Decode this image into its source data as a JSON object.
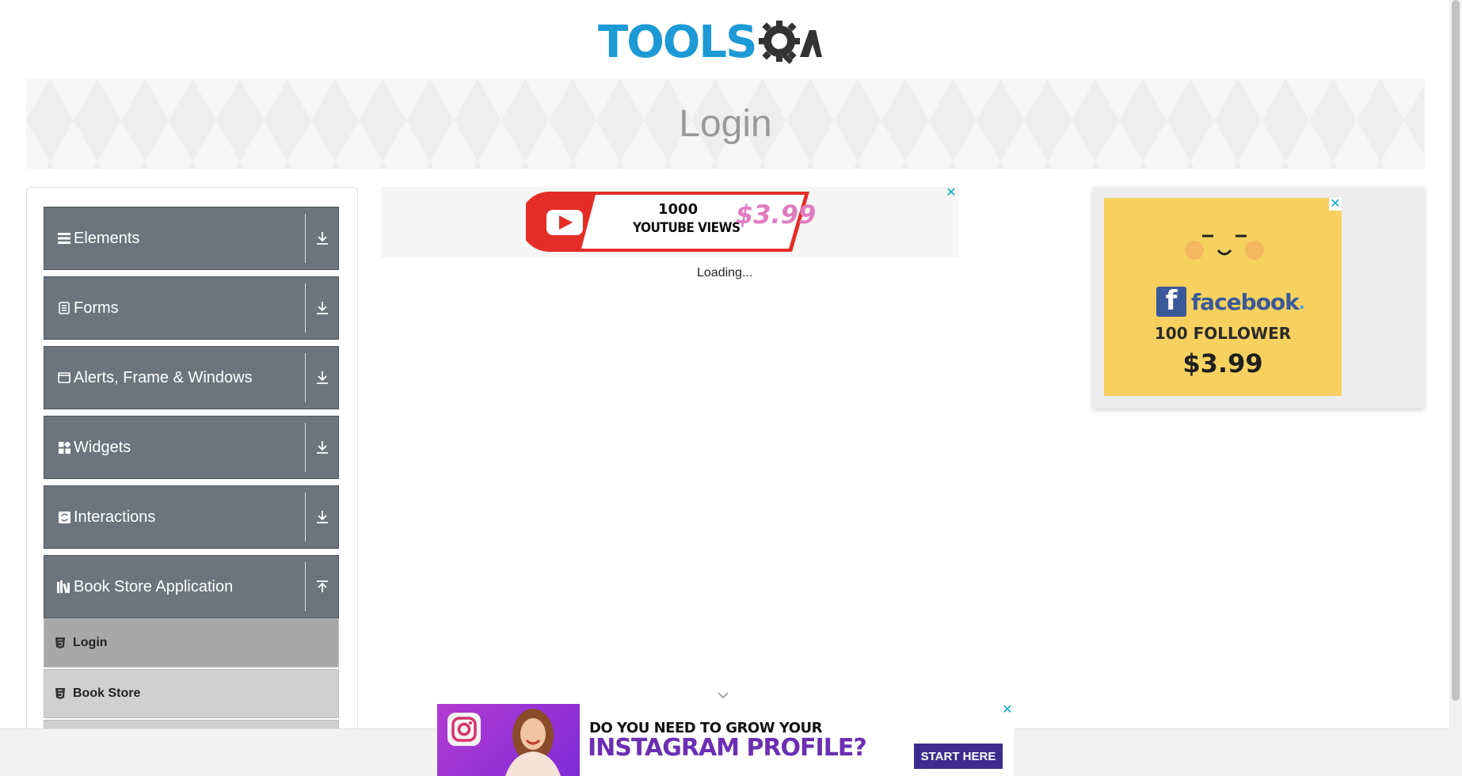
{
  "header": {
    "logo_text": "TOOLS",
    "logo_letter": "A"
  },
  "banner": {
    "title": "Login"
  },
  "sidebar": {
    "groups": [
      {
        "label": "Elements",
        "icon": "bars-icon",
        "expanded": false
      },
      {
        "label": "Forms",
        "icon": "document-icon",
        "expanded": false
      },
      {
        "label": "Alerts, Frame & Windows",
        "icon": "window-icon",
        "expanded": false
      },
      {
        "label": "Widgets",
        "icon": "widgets-icon",
        "expanded": false
      },
      {
        "label": "Interactions",
        "icon": "interactions-icon",
        "expanded": false
      },
      {
        "label": "Book Store Application",
        "icon": "books-icon",
        "expanded": true
      }
    ],
    "book_store_items": [
      {
        "label": "Login",
        "active": true
      },
      {
        "label": "Book Store",
        "active": false
      }
    ],
    "colors": {
      "group_bg": "#6c757d",
      "active_item_bg": "#a8a8a8",
      "item_bg": "#d0d0d0"
    }
  },
  "main": {
    "loading_text": "Loading..."
  },
  "ads": {
    "top": {
      "line1": "1000",
      "line2": "YOUTUBE VIEWS",
      "price": "$3.99",
      "close": "✕"
    },
    "right": {
      "brand": "facebook",
      "brand_dot": ".",
      "follower_text": "100 FOLLOWER",
      "price": "$3.99",
      "close": "✕"
    },
    "bottom": {
      "line1": "DO YOU NEED TO GROW YOUR",
      "line2": "INSTAGRAM PROFILE?",
      "button": "START HERE",
      "close": "✕"
    }
  }
}
